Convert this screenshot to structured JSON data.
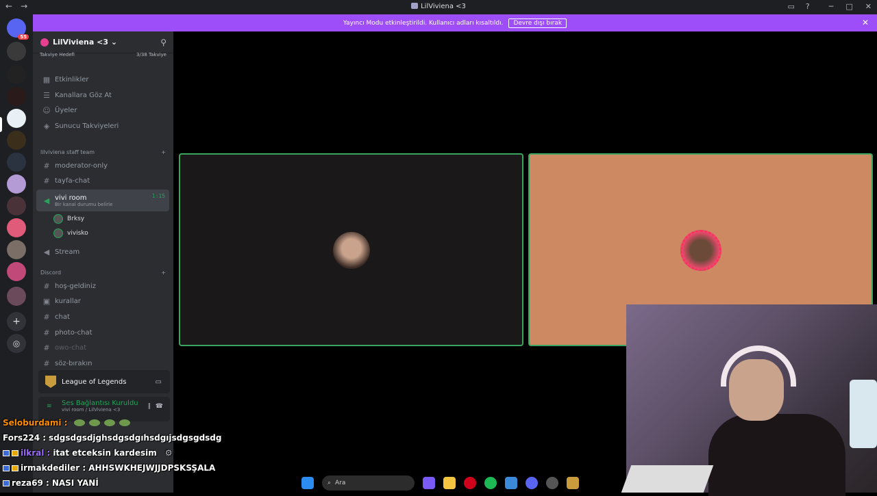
{
  "window": {
    "title": "LilViviena <3"
  },
  "banner": {
    "text": "Yayıncı Modu etkinleştirildi. Kullanıcı adları kısaltıldı.",
    "button": "Devre dışı bırak"
  },
  "rail": {
    "badge": "55"
  },
  "server": {
    "name": "LilViviena <3",
    "boost_label": "Takviye Hedefi",
    "boost_count": "3/38 Takviye"
  },
  "sidebar_top": [
    {
      "label": "Etkinlikler",
      "icon": "calendar-icon"
    },
    {
      "label": "Kanallara Göz At",
      "icon": "browse-icon"
    },
    {
      "label": "Üyeler",
      "icon": "members-icon"
    },
    {
      "label": "Sunucu Takviyeleri",
      "icon": "boost-icon"
    }
  ],
  "category1": {
    "label": "lilviviena staff team"
  },
  "channels1": [
    {
      "label": "moderator-only"
    },
    {
      "label": "tayfa-chat"
    }
  ],
  "voice_room": {
    "name": "vivi room",
    "status": "Bir kanal durumu belirle",
    "time": "1:15"
  },
  "voice_users": [
    {
      "name": "Brksy"
    },
    {
      "name": "vivisko"
    }
  ],
  "stream_channel": {
    "label": "Stream"
  },
  "category2": {
    "label": "Discord"
  },
  "channels2": [
    {
      "label": "hoş-geldiniz"
    },
    {
      "label": "kurallar"
    },
    {
      "label": "chat"
    },
    {
      "label": "photo-chat"
    },
    {
      "label": "owo-chat"
    },
    {
      "label": "söz-bırakın"
    }
  ],
  "activity": {
    "game": "League of Legends"
  },
  "voice_status": {
    "title": "Ses Bağlantısı Kuruldu",
    "sub": "vivi room / LilViviena <3"
  },
  "chat_overlay": [
    {
      "name": "Seloburdami :",
      "text": "",
      "color": "#ff8c00"
    },
    {
      "name": "Fors224 :",
      "text": "sdgsdgsdjghsdgsdgıhsdgıjsdgsgdsdg",
      "color": "#ffffff"
    },
    {
      "name": "ilkral :",
      "text": "itat etceksin kardesim",
      "color": "#9b6bff"
    },
    {
      "name": "irmakdediler :",
      "text": "AHHSWKHEJWJJDPSKSŞALA",
      "color": "#ffffff"
    },
    {
      "name": "reza69 :",
      "text": "NASI YANİ",
      "color": "#ffffff"
    }
  ],
  "taskbar": {
    "search": "Ara"
  },
  "colors": {
    "accent": "#9d4ef8",
    "speaking": "#3ba55d",
    "tile2_bg": "#cd8a62"
  }
}
